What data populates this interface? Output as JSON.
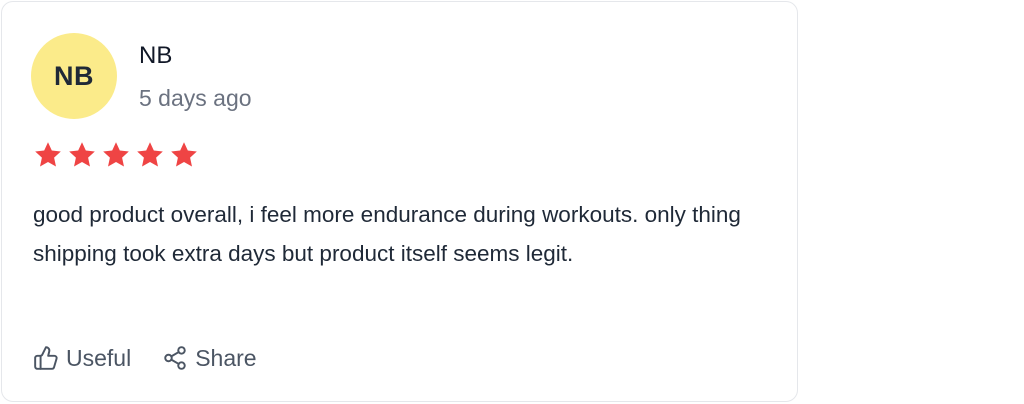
{
  "review": {
    "avatar_initials": "NB",
    "avatar_color": "#fbeb8a",
    "author": "NB",
    "time_ago": "5 days ago",
    "rating": 5,
    "rating_max": 5,
    "star_color": "#ef4444",
    "star_icon": "star-icon",
    "text": "good product overall, i feel more endurance during workouts. only thing shipping took extra days but product itself seems legit."
  },
  "actions": {
    "useful_label": "Useful",
    "useful_icon": "thumbs-up-icon",
    "share_label": "Share",
    "share_icon": "share-icon"
  }
}
